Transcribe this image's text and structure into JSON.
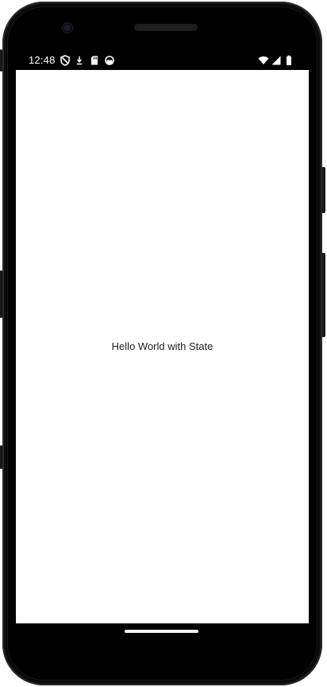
{
  "status_bar": {
    "time": "12:48",
    "left_icons": [
      "shield-icon",
      "download-icon",
      "sd-card-icon",
      "sync-circle-icon"
    ],
    "right_icons": [
      "wifi-icon",
      "cell-signal-icon",
      "battery-icon"
    ]
  },
  "screen": {
    "message": "Hello World with State",
    "background": "#ffffff",
    "text_color": "#202020"
  },
  "device": {
    "frame_color": "#000000",
    "nav_handle_color": "#f2f2f2"
  }
}
